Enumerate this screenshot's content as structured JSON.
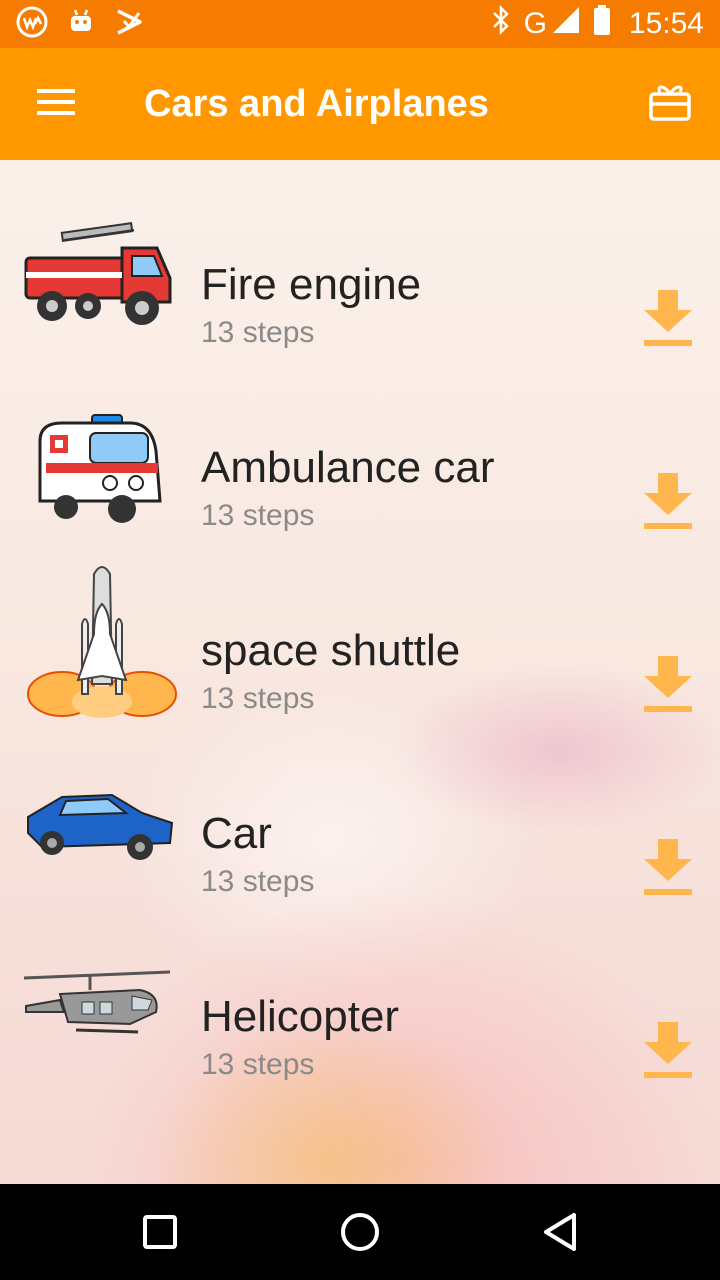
{
  "status_bar": {
    "time": "15:54",
    "network": "G",
    "left_icons": [
      "wm-app-icon",
      "android-icon",
      "play-store-icon"
    ],
    "right_icons": [
      "bluetooth-icon",
      "signal-icon",
      "battery-icon"
    ]
  },
  "app_bar": {
    "title": "Cars and Airplanes",
    "menu_icon": "hamburger-menu-icon",
    "action_icon": "gift-icon"
  },
  "list": {
    "items": [
      {
        "title": "Fire engine",
        "subtitle": "13 steps",
        "icon": "fire-engine-image"
      },
      {
        "title": "Ambulance car",
        "subtitle": "13 steps",
        "icon": "ambulance-image"
      },
      {
        "title": "space shuttle",
        "subtitle": "13 steps",
        "icon": "space-shuttle-image"
      },
      {
        "title": "Car",
        "subtitle": "13 steps",
        "icon": "car-image"
      },
      {
        "title": "Helicopter",
        "subtitle": "13 steps",
        "icon": "helicopter-image"
      }
    ],
    "download_icon": "download-icon"
  },
  "nav_bar": {
    "buttons": [
      "recents-icon",
      "home-icon",
      "back-icon"
    ]
  },
  "colors": {
    "status_bar": "#f57c00",
    "app_bar": "#ff9800",
    "accent": "#ffb74d",
    "title_text": "#222222",
    "subtitle_text": "#8a8a8a"
  }
}
